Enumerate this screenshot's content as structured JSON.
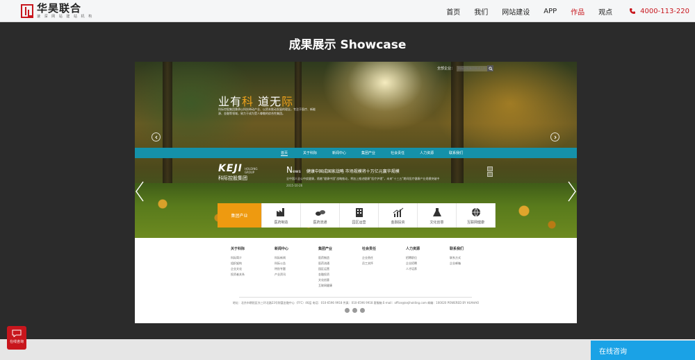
{
  "header": {
    "logo_name": "华昊联合",
    "logo_sub": "速 深 网 站 建 站 机 构",
    "nav": [
      {
        "label": "首页"
      },
      {
        "label": "我们"
      },
      {
        "label": "网站建设"
      },
      {
        "label": "APP"
      },
      {
        "label": "作品",
        "active": true
      },
      {
        "label": "观点"
      }
    ],
    "phone": "4000-113-220",
    "accent_color": "#c8161d"
  },
  "section": {
    "title": "成果展示 Showcase"
  },
  "showcase": {
    "search_label": "全部企业：",
    "search_placeholder": "科际控股集团耗成上线",
    "slogan_a": "业有",
    "slogan_b": "科",
    "slogan_c": "  道无",
    "slogan_d": "际",
    "slogan_desc": "科际控股集团秉承以科技带动产业、以资本推动发展的理念，专注于医疗、新能源、金融等领域，致力于成为受人尊敬的综合性集团。",
    "inner_nav": [
      "首页",
      "关于科际",
      "新闻中心",
      "集团产业",
      "社会责任",
      "人力资源",
      "联系我们"
    ],
    "brand_name": "KEJI",
    "brand_tag1": "HOLDING",
    "brand_tag2": "GROUP",
    "brand_cn": "科际控股集团",
    "news_head": "N",
    "news_head_rest": "ews",
    "news_title": "健康中国成国家战略 市场规模将十万亿元赢华规模",
    "news_text": "全中国人全公中疾健康，随着“健康中国”战略推动，将加上推进健康“医疗护理”，未来“十三五”期间医疗健康产业规模突破中",
    "news_date": "2015-10-26",
    "categories": [
      {
        "label": "集团产业",
        "icon": "industry-icon"
      },
      {
        "label": "医药制造",
        "icon": "factory-icon"
      },
      {
        "label": "医药流通",
        "icon": "pills-icon"
      },
      {
        "label": "园区运营",
        "icon": "building-icon"
      },
      {
        "label": "金融投资",
        "icon": "chart-icon"
      },
      {
        "label": "文化创意",
        "icon": "flask-icon"
      },
      {
        "label": "互联网健康",
        "icon": "globe-icon"
      }
    ],
    "footer_cols": [
      {
        "head": "关于科际",
        "items": [
          "科际简介",
          "组织架构",
          "企业文化",
          "投资者关系"
        ]
      },
      {
        "head": "新闻中心",
        "items": [
          "科际新闻",
          "科际公告",
          "特别专题",
          "产业资讯"
        ]
      },
      {
        "head": "集团产业",
        "items": [
          "医药制造",
          "医药流通",
          "园区运营",
          "金融投资",
          "文化创意",
          "互联网健康"
        ]
      },
      {
        "head": "社会责任",
        "items": [
          "企业责任",
          "员工关怀"
        ]
      },
      {
        "head": "人力资源",
        "items": [
          "招聘职位",
          "企业招聘",
          "人才培养"
        ]
      },
      {
        "head": "联系我们",
        "items": [
          "联系方式",
          "企业邮箱"
        ]
      }
    ],
    "copyright": "地址：北京市朝阳区东三环北路23号财富金融中心（FFC）46层 电话：010-6596 9918 传真：010-6596 9918 客服箱 E-mail：office@kejiholding.com 邮编：100020 POWERED BY HUAHAO"
  },
  "floating": {
    "chat_label": "在线咨询",
    "consult_label": "在线咨询",
    "consult_color": "#1aa2e6"
  }
}
